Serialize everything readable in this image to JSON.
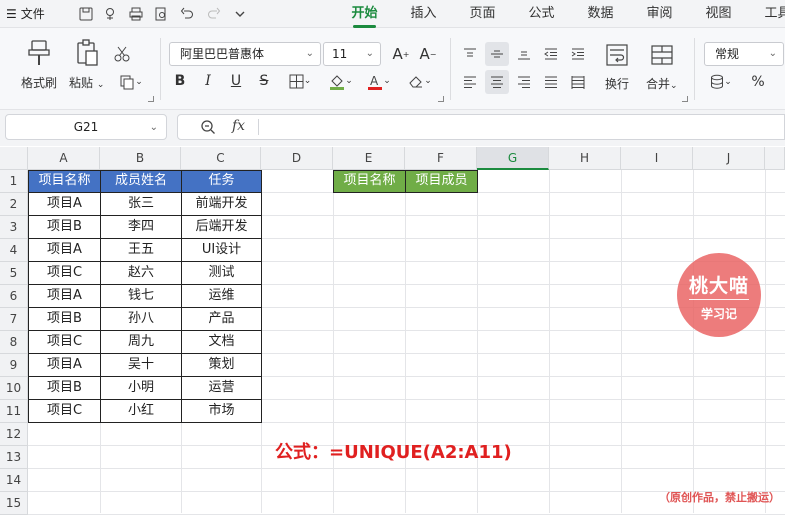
{
  "menubar": {
    "file_label": "文件",
    "tabs": [
      "开始",
      "插入",
      "页面",
      "公式",
      "数据",
      "审阅",
      "视图",
      "工具"
    ],
    "active_tab": "开始"
  },
  "ribbon": {
    "format_painter": "格式刷",
    "paste": "粘贴",
    "font_name": "阿里巴巴普惠体",
    "font_size": "11",
    "wrap": "换行",
    "merge": "合并",
    "number_format": "常规",
    "percent": "%"
  },
  "formula_bar": {
    "name_box": "G21",
    "fx": "fx",
    "content": ""
  },
  "sheet": {
    "columns": [
      "A",
      "B",
      "C",
      "D",
      "E",
      "F",
      "G",
      "H",
      "I",
      "J"
    ],
    "rows": [
      "1",
      "2",
      "3",
      "4",
      "5",
      "6",
      "7",
      "8",
      "9",
      "10",
      "11",
      "12",
      "13",
      "14",
      "15"
    ],
    "selected_column": "G",
    "table1_headers": [
      "项目名称",
      "成员姓名",
      "任务"
    ],
    "table1_rows": [
      [
        "项目A",
        "张三",
        "前端开发"
      ],
      [
        "项目B",
        "李四",
        "后端开发"
      ],
      [
        "项目A",
        "王五",
        "UI设计"
      ],
      [
        "项目C",
        "赵六",
        "测试"
      ],
      [
        "项目A",
        "钱七",
        "运维"
      ],
      [
        "项目B",
        "孙八",
        "产品"
      ],
      [
        "项目C",
        "周九",
        "文档"
      ],
      [
        "项目A",
        "吴十",
        "策划"
      ],
      [
        "项目B",
        "小明",
        "运营"
      ],
      [
        "项目C",
        "小红",
        "市场"
      ]
    ],
    "table2_headers": [
      "项目名称",
      "项目成员"
    ]
  },
  "annotation": {
    "formula_text": "公式：=UNIQUE(A2:A11)"
  },
  "watermark": {
    "title": "桃大喵",
    "subtitle": "学习记",
    "note": "（原创作品，禁止搬运）"
  },
  "colors": {
    "accent": "#1b8a3e",
    "header_blue": "#4472c4",
    "header_green": "#70ad47",
    "formula_red": "#e02020"
  }
}
